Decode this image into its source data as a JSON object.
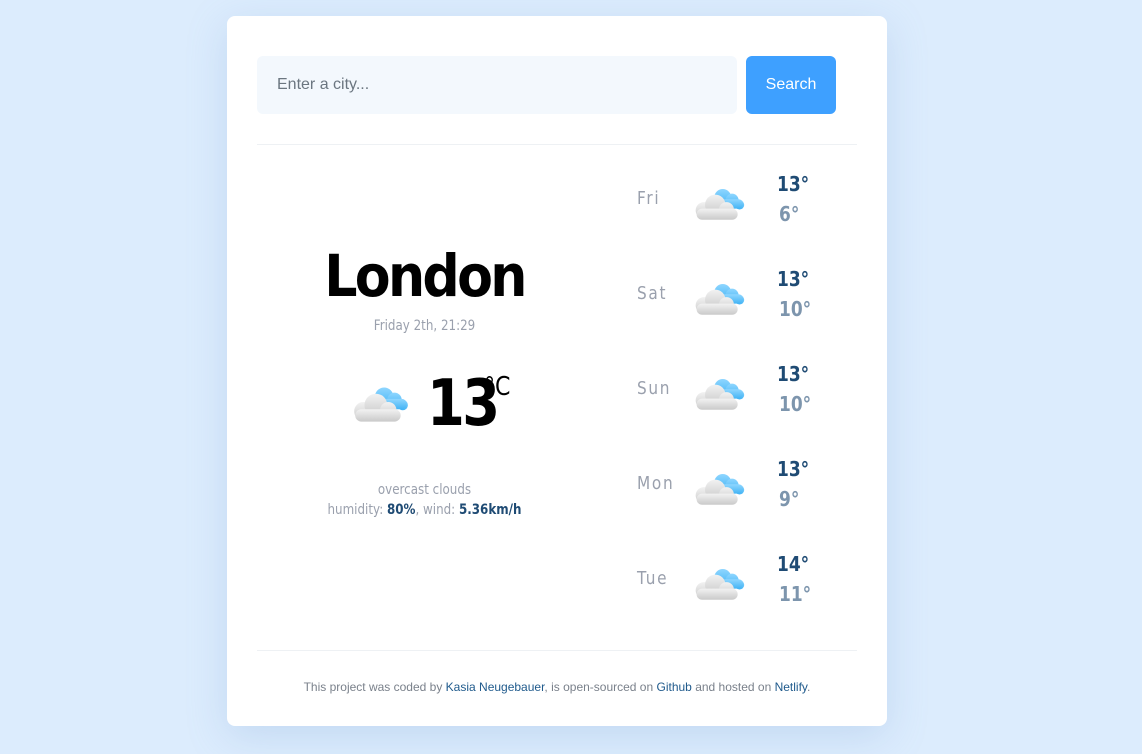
{
  "search": {
    "placeholder": "Enter a city...",
    "button_label": "Search"
  },
  "current": {
    "city": "London",
    "date": "Friday 2th, 21:29",
    "temperature": "13",
    "unit": "°C",
    "icon": "cloud-icon",
    "description": "overcast clouds",
    "humidity_label": "humidity: ",
    "humidity_value": "80%",
    "wind_label": ", wind: ",
    "wind_value": "5.36km/h"
  },
  "forecast": [
    {
      "day": "Fri",
      "icon": "cloud-icon",
      "max": "13°",
      "min": "6°"
    },
    {
      "day": "Sat",
      "icon": "cloud-icon",
      "max": "13°",
      "min": "10°"
    },
    {
      "day": "Sun",
      "icon": "cloud-icon",
      "max": "13°",
      "min": "10°"
    },
    {
      "day": "Mon",
      "icon": "cloud-icon",
      "max": "13°",
      "min": "9°"
    },
    {
      "day": "Tue",
      "icon": "cloud-icon",
      "max": "14°",
      "min": "11°"
    }
  ],
  "footer": {
    "text_1": "This project was coded by ",
    "author_link": "Kasia Neugebauer",
    "text_2": ", is open-sourced on ",
    "github_link": "Github",
    "text_3": " and hosted on ",
    "netlify_link": "Netlify",
    "text_4": "."
  },
  "colors": {
    "background": "#dcecfd",
    "accent": "#3ea0ff",
    "dark_blue": "#1f4b74",
    "muted": "#9aa0ad"
  }
}
